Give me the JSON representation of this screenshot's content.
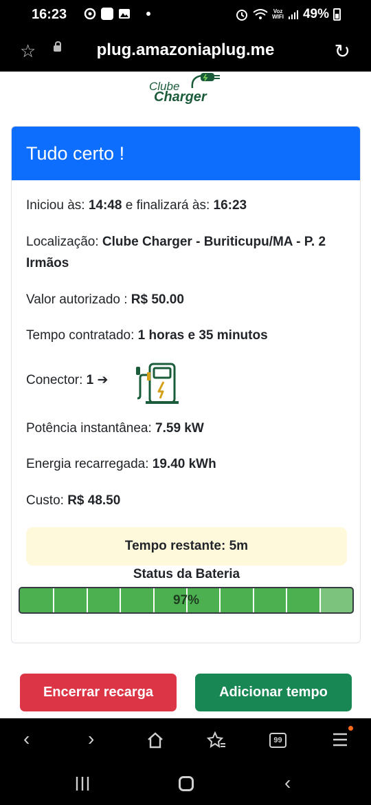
{
  "status_bar": {
    "time": "16:23",
    "network_label": "Voz\nWIFI",
    "battery": "49%"
  },
  "browser": {
    "url": "plug.amazoniaplug.me",
    "star_icon": "star-outline-icon",
    "reload_icon": "reload-icon",
    "tab_count": "99"
  },
  "logo": {
    "line1": "Clube",
    "line2": "Charger"
  },
  "card": {
    "header": "Tudo certo !",
    "start_label": "Iniciou às:",
    "start_time": "14:48",
    "end_label": "e finalizará às:",
    "end_time": "16:23",
    "location_label": "Localização:",
    "location_value": "Clube Charger - Buriticupu/MA - P. 2 Irmãos",
    "authorized_label": "Valor autorizado :",
    "authorized_value": "R$ 50.00",
    "contracted_label": "Tempo contratado:",
    "contracted_value": "1 horas e 35 minutos",
    "connector_label": "Conector:",
    "connector_value": "1 ➔",
    "power_label": "Potência instantânea:",
    "power_value": "7.59 kW",
    "energy_label": "Energia recarregada:",
    "energy_value": "19.40 kWh",
    "cost_label": "Custo:",
    "cost_value": "R$ 48.50",
    "remaining": "Tempo restante: 5m",
    "battery_title": "Status da Bateria",
    "battery_percent_text": "97%",
    "battery_fraction": 0.9
  },
  "buttons": {
    "end": "Encerrar recarga",
    "add": "Adicionar tempo"
  },
  "colors": {
    "header_blue": "#0d6efd",
    "danger": "#dc3545",
    "success": "#198754",
    "battery_green": "#4caf50",
    "remaining_bg": "#fff9dc"
  }
}
